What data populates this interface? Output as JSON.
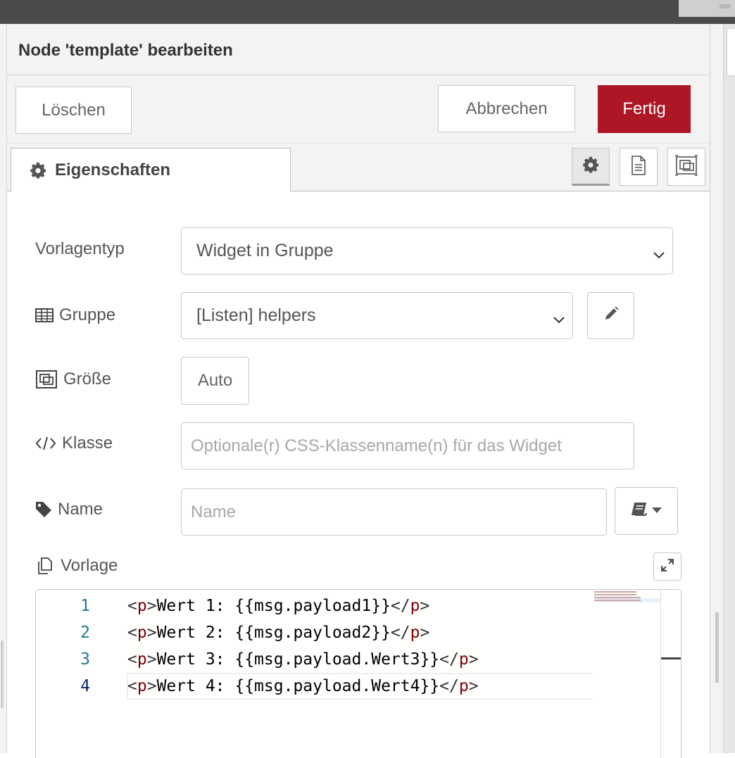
{
  "dialog": {
    "title": "Node 'template' bearbeiten",
    "buttons": {
      "delete": "Löschen",
      "cancel": "Abbrechen",
      "done": "Fertig"
    },
    "accent_color": "#ad1625"
  },
  "tabs": {
    "active_label": "Eigenschaften",
    "icon_buttons": [
      "gear-icon",
      "document-icon",
      "layout-icon"
    ]
  },
  "form": {
    "template_type": {
      "label": "Vorlagentyp",
      "value": "Widget in Gruppe"
    },
    "group": {
      "label": "Gruppe",
      "value": "[Listen] helpers"
    },
    "size": {
      "label": "Größe",
      "value": "Auto"
    },
    "class": {
      "label": "Klasse",
      "placeholder": "Optionale(r) CSS-Klassenname(n) für das Widget"
    },
    "name": {
      "label": "Name",
      "placeholder": "Name"
    },
    "template": {
      "label": "Vorlage"
    }
  },
  "editor": {
    "lines": [
      {
        "num": "1",
        "text": "Wert 1: {{msg.payload1}}"
      },
      {
        "num": "2",
        "text": "Wert 2: {{msg.payload2}}"
      },
      {
        "num": "3",
        "text": "Wert 3: {{msg.payload.Wert3}}"
      },
      {
        "num": "4",
        "text": "Wert 4: {{msg.payload.Wert4}}"
      }
    ],
    "tag_open": "<p>",
    "tag_close": "</p>"
  }
}
